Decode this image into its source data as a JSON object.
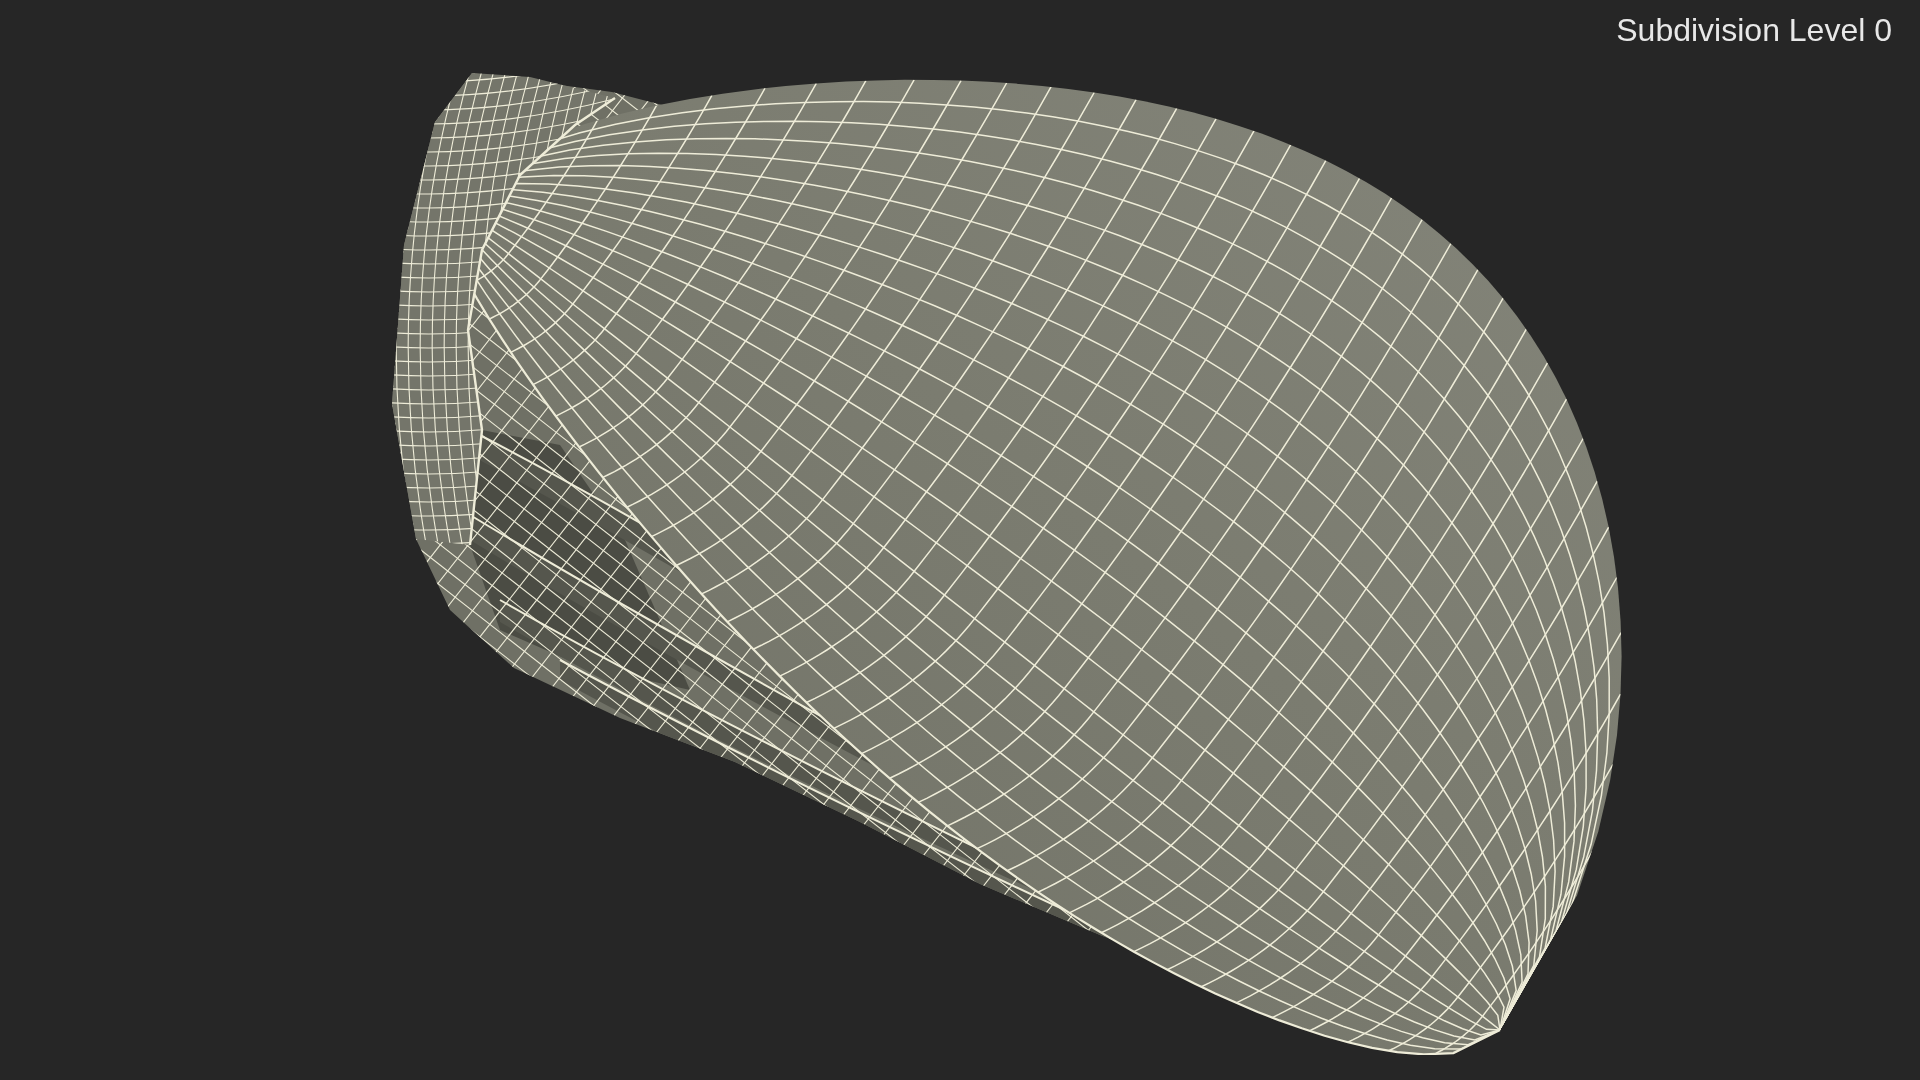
{
  "viewport": {
    "overlay_label": "Subdivision Level 0"
  }
}
